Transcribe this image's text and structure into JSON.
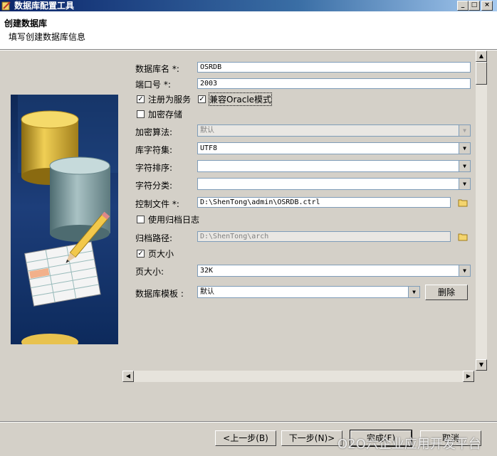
{
  "window": {
    "title": "数据库配置工具",
    "min": "_",
    "max": "□",
    "close": "×"
  },
  "header": {
    "title": "创建数据库",
    "subtitle": "填写创建数据库信息"
  },
  "form": {
    "db_name_label": "数据库名 *:",
    "db_name_value": "OSRDB",
    "port_label": "端口号 *:",
    "port_value": "2003",
    "register_service_label": "注册为服务",
    "register_service_checked": true,
    "oracle_compat_label": "兼容Oracle模式",
    "oracle_compat_checked": true,
    "encrypt_storage_label": "加密存储",
    "encrypt_storage_checked": false,
    "encrypt_algo_label": "加密算法:",
    "encrypt_algo_value": "默认",
    "charset_label": "库字符集:",
    "charset_value": "UTF8",
    "collation_label": "字符排序:",
    "collation_value": "",
    "char_class_label": "字符分类:",
    "char_class_value": "",
    "control_file_label": "控制文件 *:",
    "control_file_value": "D:\\ShenTong\\admin\\OSRDB.ctrl",
    "archive_log_label": "使用归档日志",
    "archive_log_checked": false,
    "archive_path_label": "归档路径:",
    "archive_path_value": "D:\\ShenTong\\arch",
    "page_size_check_label": "页大小",
    "page_size_checked": true,
    "page_size_label": "页大小:",
    "page_size_value": "32K",
    "template_label": "数据库模板 :",
    "template_value": "默认",
    "delete_button": "删除"
  },
  "footer": {
    "prev_button": "<上一步(B)",
    "next_button": "下一步(N)>",
    "finish_button": "完成(F)",
    "cancel_button": "取消"
  },
  "watermark": "O2O六企业应用开发平台",
  "icons": {
    "check": "✓",
    "dropdown": "▼",
    "left": "◀",
    "right": "▶",
    "up": "▲",
    "down": "▼"
  }
}
